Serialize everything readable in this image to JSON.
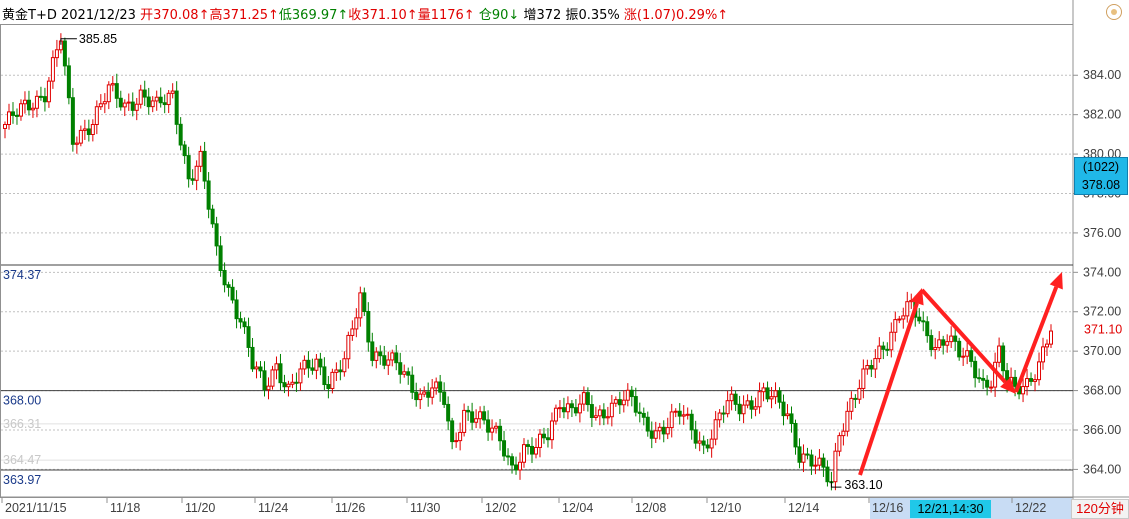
{
  "header": {
    "instrument": "黄金T+D",
    "date": "2021/12/23",
    "open_label": "开",
    "open": "370.08↑",
    "high_label": "高",
    "high": "371.25↑",
    "low_label": "低",
    "low": "369.97↑",
    "close_label": "收",
    "close": "371.10↑",
    "vol_label": "量",
    "vol": "1176↑",
    "oi_label": "仓",
    "oi": "90↓",
    "inc_label": "增",
    "inc": "372",
    "amp_label": "振",
    "amp": "0.35%",
    "chg_label": "涨",
    "chg": "(1.07)",
    "chg_pct": "0.29%↑"
  },
  "colors": {
    "up": "#e00000",
    "down": "#008000",
    "arrow": "#ff2020",
    "accent": "#20b8e8"
  },
  "cursor_box": {
    "line1": "(1022)",
    "line2": "378.08"
  },
  "cursor_date": "12/21,14:30",
  "period_label": "120分钟",
  "chart_data": {
    "type": "candlestick",
    "ylim": [
      362.6,
      386.6
    ],
    "yticks": [
      "364.00",
      "366.00",
      "368.00",
      "370.00",
      "372.00",
      "374.00",
      "376.00",
      "378.00",
      "380.00",
      "382.00",
      "384.00"
    ],
    "x_labels": [
      "2021/11/15",
      "11/18",
      "11/20",
      "11/24",
      "11/26",
      "11/30",
      "12/02",
      "12/04",
      "12/08",
      "12/10",
      "12/14",
      "12/16",
      "12/22"
    ],
    "high_mark": "385.85",
    "low_mark": "363.10",
    "last_price": "371.10",
    "h_levels": [
      {
        "value": 374.37,
        "label": "374.37"
      },
      {
        "value": 368.0,
        "label": "368.00"
      },
      {
        "value": 363.97,
        "label": "363.97"
      }
    ],
    "faint_levels": [
      {
        "value": 366.31,
        "label": "366.31"
      },
      {
        "value": 364.47,
        "label": "364.47"
      }
    ],
    "waypoints": [
      [
        0,
        381.5
      ],
      [
        6,
        382.5
      ],
      [
        10,
        383.2
      ],
      [
        14,
        385.85
      ],
      [
        17,
        380.6
      ],
      [
        22,
        381.8
      ],
      [
        26,
        383.2
      ],
      [
        30,
        382.4
      ],
      [
        34,
        383.1
      ],
      [
        38,
        382.3
      ],
      [
        42,
        383.0
      ],
      [
        46,
        378.8
      ],
      [
        49,
        379.6
      ],
      [
        53,
        375.0
      ],
      [
        56,
        373.2
      ],
      [
        59,
        371.6
      ],
      [
        62,
        369.2
      ],
      [
        65,
        368.2
      ],
      [
        68,
        369.4
      ],
      [
        71,
        368.0
      ],
      [
        74,
        368.8
      ],
      [
        78,
        369.5
      ],
      [
        81,
        368.5
      ],
      [
        85,
        369.4
      ],
      [
        87,
        371.0
      ],
      [
        89,
        372.8
      ],
      [
        92,
        370.0
      ],
      [
        95,
        369.6
      ],
      [
        98,
        369.2
      ],
      [
        101,
        368.5
      ],
      [
        104,
        367.8
      ],
      [
        107,
        368.2
      ],
      [
        110,
        367.4
      ],
      [
        112,
        365.0
      ],
      [
        115,
        367.0
      ],
      [
        118,
        366.8
      ],
      [
        121,
        366.0
      ],
      [
        124,
        365.5
      ],
      [
        127,
        364.2
      ],
      [
        130,
        365.0
      ],
      [
        133,
        364.9
      ],
      [
        136,
        365.8
      ],
      [
        139,
        367.6
      ],
      [
        142,
        367.0
      ],
      [
        145,
        367.3
      ],
      [
        148,
        366.6
      ],
      [
        151,
        367.2
      ],
      [
        154,
        367.6
      ],
      [
        157,
        367.4
      ],
      [
        160,
        366.3
      ],
      [
        163,
        366.0
      ],
      [
        166,
        366.3
      ],
      [
        169,
        366.8
      ],
      [
        172,
        366.1
      ],
      [
        175,
        365.2
      ],
      [
        178,
        366.2
      ],
      [
        181,
        367.3
      ],
      [
        184,
        367.2
      ],
      [
        187,
        367.5
      ],
      [
        190,
        367.9
      ],
      [
        193,
        367.4
      ],
      [
        196,
        366.8
      ],
      [
        199,
        364.9
      ],
      [
        202,
        364.4
      ],
      [
        205,
        363.8
      ],
      [
        207,
        363.3
      ],
      [
        209,
        366.0
      ],
      [
        212,
        367.5
      ],
      [
        215,
        368.6
      ],
      [
        218,
        369.5
      ],
      [
        221,
        370.6
      ],
      [
        224,
        372.0
      ],
      [
        227,
        372.2
      ],
      [
        230,
        371.0
      ],
      [
        233,
        370.3
      ],
      [
        236,
        370.9
      ],
      [
        239,
        369.8
      ],
      [
        242,
        369.3
      ],
      [
        245,
        368.4
      ],
      [
        247,
        368.7
      ],
      [
        249,
        370.0
      ],
      [
        251,
        368.3
      ],
      [
        253,
        367.9
      ],
      [
        256,
        368.4
      ],
      [
        259,
        369.5
      ],
      [
        262,
        371.1
      ]
    ],
    "arrows": [
      {
        "from": [
          860,
          475
        ],
        "to": [
          922,
          288
        ]
      },
      {
        "from": [
          922,
          290
        ],
        "to": [
          1016,
          394
        ]
      },
      {
        "from": [
          1016,
          392
        ],
        "to": [
          1062,
          272
        ]
      }
    ]
  }
}
